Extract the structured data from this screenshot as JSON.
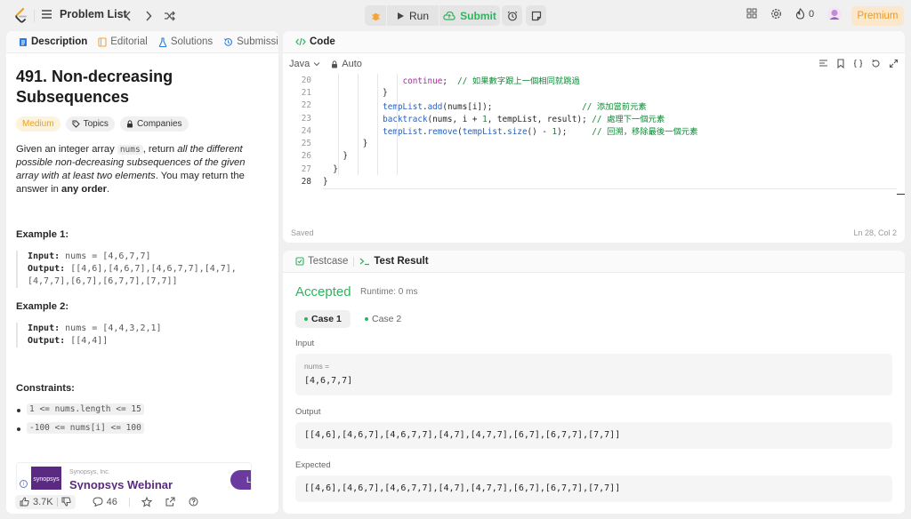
{
  "nav": {
    "problem_list": "Problem List",
    "run": "Run",
    "submit": "Submit",
    "streak": "0",
    "premium": "Premium"
  },
  "left": {
    "tabs": [
      "Description",
      "Editorial",
      "Solutions",
      "Submissions"
    ],
    "title": "491. Non-decreasing Subsequences",
    "difficulty": "Medium",
    "topics": "Topics",
    "companies": "Companies",
    "desc_1": "Given an integer array ",
    "desc_code": "nums",
    "desc_2": ", return ",
    "desc_em": "all the different possible non-decreasing subsequences of the given array with at least two elements",
    "desc_3": ". You may return the answer in ",
    "desc_bold": "any order",
    "desc_4": ".",
    "examples": [
      {
        "title": "Example 1:",
        "input_label": "Input:",
        "input": "nums = [4,6,7,7]",
        "output_label": "Output:",
        "output_1": "[[4,6],[4,6,7],[4,6,7,7],[4,7],",
        "output_2": "[4,7,7],[6,7],[6,7,7],[7,7]]"
      },
      {
        "title": "Example 2:",
        "input_label": "Input:",
        "input": "nums = [4,4,3,2,1]",
        "output_label": "Output:",
        "output_1": "[[4,4]]"
      }
    ],
    "constraints_title": "Constraints:",
    "constraints": [
      "1 <= nums.length <= 15",
      "-100 <= nums[i] <= 100"
    ],
    "ad": {
      "company": "Synopsys, Inc.",
      "title": "Synopsys Webinar",
      "logo_text": "synopsys",
      "button": "L"
    },
    "likes": "3.7K",
    "comments": "46"
  },
  "code": {
    "tab": "Code",
    "language": "Java",
    "mode": "Auto",
    "lines": [
      {
        "n": "20",
        "indent": "                ",
        "parts": [
          [
            "kw",
            "continue"
          ],
          [
            "",
            "; "
          ],
          [
            "cm",
            " // 如果數字跟上一個相同就跳過"
          ]
        ]
      },
      {
        "n": "21",
        "indent": "            ",
        "parts": [
          [
            "",
            "}"
          ]
        ]
      },
      {
        "n": "22",
        "indent": "            ",
        "parts": [
          [
            "fn",
            "tempList"
          ],
          [
            "",
            "."
          ],
          [
            "fn",
            "add"
          ],
          [
            "",
            "(nums[i]);                  "
          ],
          [
            "cm",
            "// 添加當前元素"
          ]
        ]
      },
      {
        "n": "23",
        "indent": "            ",
        "parts": [
          [
            "fn",
            "backtrack"
          ],
          [
            "",
            "(nums, i + "
          ],
          [
            "num",
            "1"
          ],
          [
            "",
            ", tempList, result); "
          ],
          [
            "cm",
            "// 處理下一個元素"
          ]
        ]
      },
      {
        "n": "24",
        "indent": "            ",
        "parts": [
          [
            "fn",
            "tempList"
          ],
          [
            "",
            "."
          ],
          [
            "fn",
            "remove"
          ],
          [
            "",
            "("
          ],
          [
            "fn",
            "tempList"
          ],
          [
            "",
            "."
          ],
          [
            "fn",
            "size"
          ],
          [
            "",
            "() - "
          ],
          [
            "num",
            "1"
          ],
          [
            "",
            "); "
          ],
          [
            "cm",
            "    // 回溯，移除最後一個元素"
          ]
        ]
      },
      {
        "n": "25",
        "indent": "        ",
        "parts": [
          [
            "",
            "}"
          ]
        ]
      },
      {
        "n": "26",
        "indent": "    ",
        "parts": [
          [
            "",
            "}"
          ]
        ]
      },
      {
        "n": "27",
        "indent": "  ",
        "parts": [
          [
            "",
            "}"
          ]
        ]
      },
      {
        "n": "28",
        "indent": "",
        "parts": [
          [
            "",
            "}"
          ]
        ]
      }
    ],
    "saved": "Saved",
    "cursor": "Ln 28, Col 2"
  },
  "result": {
    "tabs": [
      "Testcase",
      "Test Result"
    ],
    "status": "Accepted",
    "runtime": "Runtime: 0 ms",
    "cases": [
      "Case 1",
      "Case 2"
    ],
    "input_label": "Input",
    "var_name": "nums =",
    "input_value": "[4,6,7,7]",
    "output_label": "Output",
    "output_value": "[[4,6],[4,6,7],[4,6,7,7],[4,7],[4,7,7],[6,7],[6,7,7],[7,7]]",
    "expected_label": "Expected",
    "expected_value": "[[4,6],[4,6,7],[4,6,7,7],[4,7],[4,7,7],[6,7],[6,7,7],[7,7]]"
  },
  "colors": {
    "accent_green": "#2db55d",
    "medium": "#e8a317",
    "premium": "#e69a2a"
  }
}
